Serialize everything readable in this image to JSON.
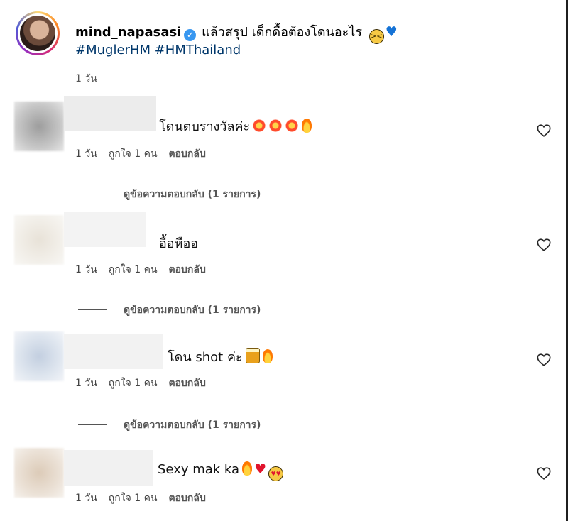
{
  "caption": {
    "username": "mind_napasasi",
    "text": "แล้วสรุป เด็กดื้อต้องโดนอะไร",
    "hashtags": "#MuglerHM #HMThailand",
    "time": "1 วัน",
    "emoji": [
      "grinning-squinting-face",
      "blue-heart"
    ]
  },
  "comments": [
    {
      "text": "โดนตบรางวัลค่ะ",
      "emoji": [
        "collision",
        "collision",
        "collision",
        "fire"
      ],
      "time": "1 วัน",
      "likes": "ถูกใจ 1 คน",
      "reply": "ตอบกลับ",
      "view_replies": "ดูข้อความตอบกลับ (1 รายการ)"
    },
    {
      "text": "อื้อหืออ",
      "emoji": [],
      "time": "1 วัน",
      "likes": "ถูกใจ 1 คน",
      "reply": "ตอบกลับ",
      "view_replies": "ดูข้อความตอบกลับ (1 รายการ)"
    },
    {
      "text": "โดน shot ค่ะ",
      "emoji": [
        "tumbler-glass",
        "fire"
      ],
      "time": "1 วัน",
      "likes": "ถูกใจ 1 คน",
      "reply": "ตอบกลับ",
      "view_replies": "ดูข้อความตอบกลับ (1 รายการ)"
    },
    {
      "text": "Sexy mak ka",
      "emoji": [
        "fire",
        "red-heart",
        "heart-eyes"
      ],
      "time": "1 วัน",
      "likes": "ถูกใจ 1 คน",
      "reply": "ตอบกลับ"
    }
  ],
  "colors": {
    "hashtag": "#00376b",
    "verified": "#3897f0",
    "blue_heart": "#1573d6",
    "meta_text": "#444444"
  }
}
